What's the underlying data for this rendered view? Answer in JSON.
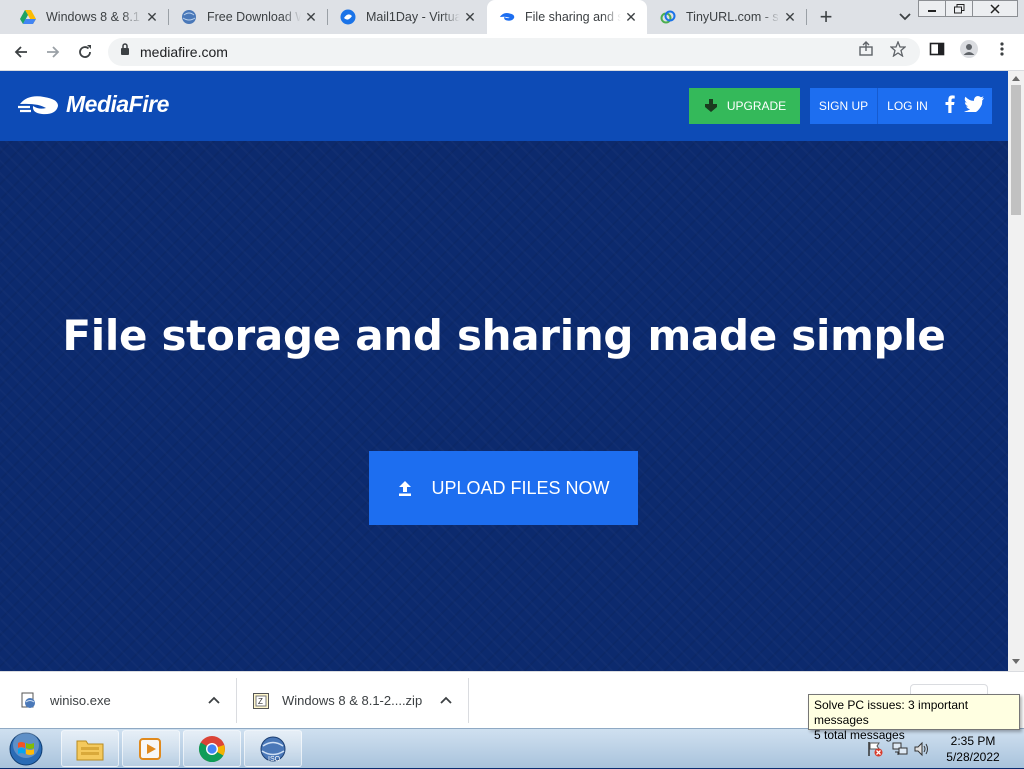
{
  "browser": {
    "tabs": [
      {
        "title": "Windows 8 & 8.1",
        "favicon": "google-drive-icon"
      },
      {
        "title": "Free Download W",
        "favicon": "winiso-icon"
      },
      {
        "title": "Mail1Day - Virtua",
        "favicon": "mail1day-icon"
      },
      {
        "title": "File sharing and st",
        "favicon": "mediafire-icon",
        "active": true
      },
      {
        "title": "TinyURL.com - sh",
        "favicon": "tinyurl-icon"
      }
    ],
    "url": "mediafire.com"
  },
  "site": {
    "logo_text": "MediaFire",
    "nav": {
      "upgrade": "UPGRADE",
      "signup": "SIGN UP",
      "login": "LOG IN"
    },
    "hero_title": "File storage and sharing made simple",
    "upload_button": "UPLOAD FILES NOW"
  },
  "downloads": [
    {
      "name": "winiso.exe",
      "icon": "exe-file-icon"
    },
    {
      "name": "Windows 8 & 8.1-2....zip",
      "icon": "zip-file-icon"
    }
  ],
  "tooltip": {
    "line1": "Solve PC issues: 3 important messages",
    "line2": "5 total messages"
  },
  "clock": {
    "time": "2:35 PM",
    "date": "5/28/2022"
  },
  "colors": {
    "header_blue": "#0d4bb6",
    "hero_navy": "#0c2a6e",
    "button_blue": "#1d6ef0",
    "upgrade_green": "#34b95a"
  }
}
